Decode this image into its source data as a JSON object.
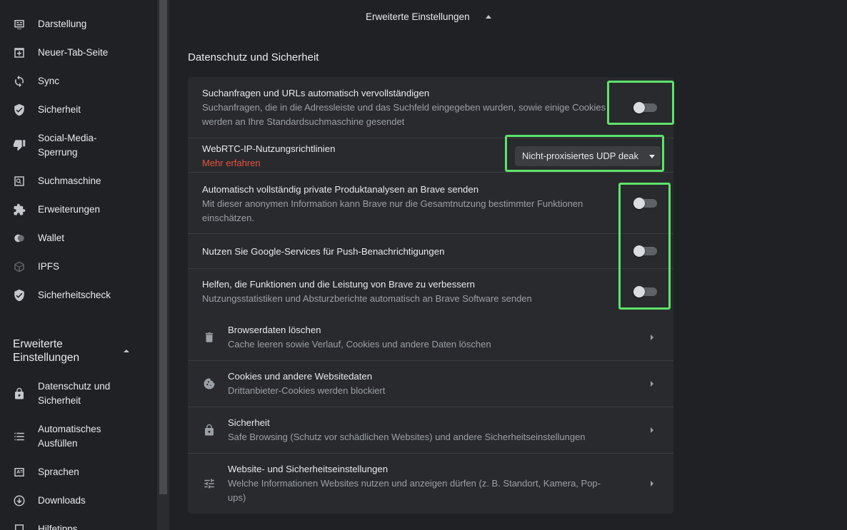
{
  "sidebar": {
    "items": [
      {
        "label": "Darstellung",
        "icon": "appearance-icon"
      },
      {
        "label": "Neuer-Tab-Seite",
        "icon": "new-tab-icon"
      },
      {
        "label": "Sync",
        "icon": "sync-icon"
      },
      {
        "label": "Sicherheit",
        "icon": "shield-icon"
      },
      {
        "label": "Social-Media-Sperrung",
        "label_line1": "Social-Media-",
        "label_line2": "Sperrung",
        "icon": "thumbs-down-icon"
      },
      {
        "label": "Suchmaschine",
        "icon": "search-icon"
      },
      {
        "label": "Erweiterungen",
        "icon": "puzzle-icon"
      },
      {
        "label": "Wallet",
        "icon": "wallet-icon"
      },
      {
        "label": "IPFS",
        "icon": "cube-icon"
      },
      {
        "label": "Sicherheitscheck",
        "icon": "shield-check-icon"
      }
    ],
    "advanced": {
      "label_line1": "Erweiterte",
      "label_line2": "Einstellungen",
      "items": [
        {
          "label_line1": "Datenschutz und",
          "label_line2": "Sicherheit",
          "icon": "lock-icon"
        },
        {
          "label_line1": "Automatisches",
          "label_line2": "Ausfüllen",
          "icon": "list-icon"
        },
        {
          "label": "Sprachen",
          "icon": "language-icon"
        },
        {
          "label": "Downloads",
          "icon": "download-icon"
        },
        {
          "label": "Hilfetipps",
          "icon": "help-icon"
        }
      ]
    }
  },
  "main": {
    "advanced_header": "Erweiterte Einstellungen",
    "section_title": "Datenschutz und Sicherheit",
    "toggles": [
      {
        "title": "Suchanfragen und URLs automatisch vervollständigen",
        "subtitle_line1": "Suchanfragen, die in die Adressleiste und das Suchfeld eingegeben wurden, sowie einige Cookies",
        "subtitle_line2": "werden an Ihre Standardsuchmaschine gesendet",
        "enabled": false
      },
      {
        "title": "Automatisch vollständig private Produktanalysen an Brave senden",
        "subtitle_line1": "Mit dieser anonymen Information kann Brave nur die Gesamtnutzung bestimmter Funktionen",
        "subtitle_line2": "einschätzen.",
        "enabled": false
      },
      {
        "title": "Nutzen Sie Google-Services für Push-Benachrichtigungen",
        "enabled": false
      },
      {
        "title": "Helfen, die Funktionen und die Leistung von Brave zu verbessern",
        "subtitle_line1": "Nutzungsstatistiken und Absturzberichte automatisch an Brave Software senden",
        "enabled": false
      }
    ],
    "webrtc": {
      "title": "WebRTC-IP-Nutzungsrichtlinien",
      "link": "Mehr erfahren",
      "selected": "Nicht-proxisiertes UDP deak"
    },
    "subpages": [
      {
        "title": "Browserdaten löschen",
        "desc": "Cache leeren sowie Verlauf, Cookies und andere Daten löschen",
        "icon": "trash-icon"
      },
      {
        "title": "Cookies und andere Websitedaten",
        "desc": "Drittanbieter-Cookies werden blockiert",
        "icon": "cookie-icon"
      },
      {
        "title": "Sicherheit",
        "desc": "Safe Browsing (Schutz vor schädlichen Websites) und andere Sicherheitseinstellungen",
        "icon": "lock-icon"
      },
      {
        "title": "Website- und Sicherheitseinstellungen",
        "desc_line1": "Welche Informationen Websites nutzen und anzeigen dürfen (z. B. Standort, Kamera, Pop-",
        "desc_line2": "ups)",
        "icon": "tune-icon"
      }
    ]
  },
  "colors": {
    "background": "#202124",
    "card": "#292a2d",
    "link": "#e8513e",
    "highlight": "#5ee36a"
  }
}
